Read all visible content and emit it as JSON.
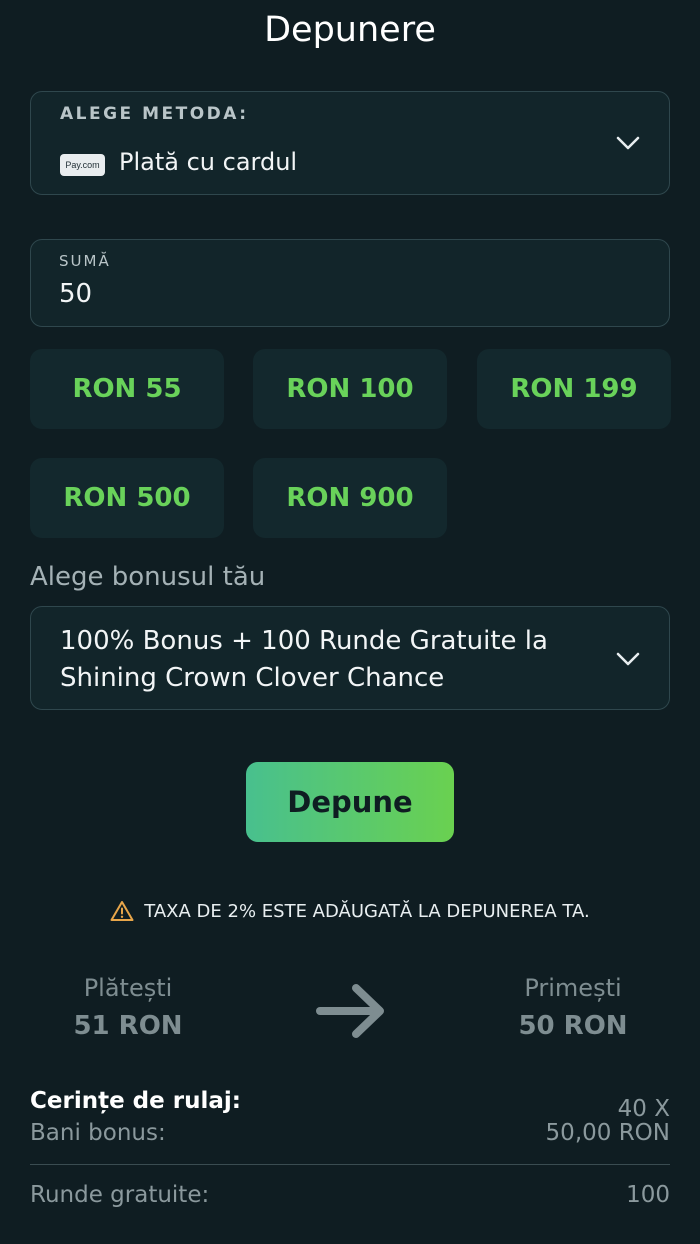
{
  "header": {
    "title": "Depunere"
  },
  "method": {
    "label": "ALEGE METODA:",
    "logo_text": "Pay.com",
    "value": "Plată cu cardul",
    "icon": "chevron-down-icon"
  },
  "amount": {
    "label": "SUMĂ",
    "value": "50"
  },
  "quick_amounts": [
    "RON 55",
    "RON 100",
    "RON 199",
    "RON 500",
    "RON 900"
  ],
  "bonus": {
    "heading": "Alege bonusul tău",
    "selected": "100% Bonus + 100 Runde Gratuite la Shining Crown Clover Chance",
    "icon": "chevron-down-icon"
  },
  "submit": {
    "label": "Depune"
  },
  "fee_notice": {
    "icon": "warning-icon",
    "text": "TAXA DE 2% ESTE ADĂUGATĂ LA DEPUNEREA TA."
  },
  "summary": {
    "pay_label": "Plătești",
    "pay_value": "51 RON",
    "arrow_icon": "arrow-right-icon",
    "receive_label": "Primești",
    "receive_value": "50 RON"
  },
  "requirements": {
    "wagering_label": "Cerințe de rulaj:",
    "wagering_value": "40 X",
    "bonus_money_label": "Bani bonus:",
    "bonus_money_value": "50,00 RON",
    "free_spins_label": "Runde gratuite:",
    "free_spins_value": "100"
  },
  "colors": {
    "background": "#0f1d22",
    "accent_green": "#69d25a",
    "button_gradient_start": "#48c08e",
    "button_gradient_end": "#6ad150",
    "warning": "#e8a64a"
  }
}
